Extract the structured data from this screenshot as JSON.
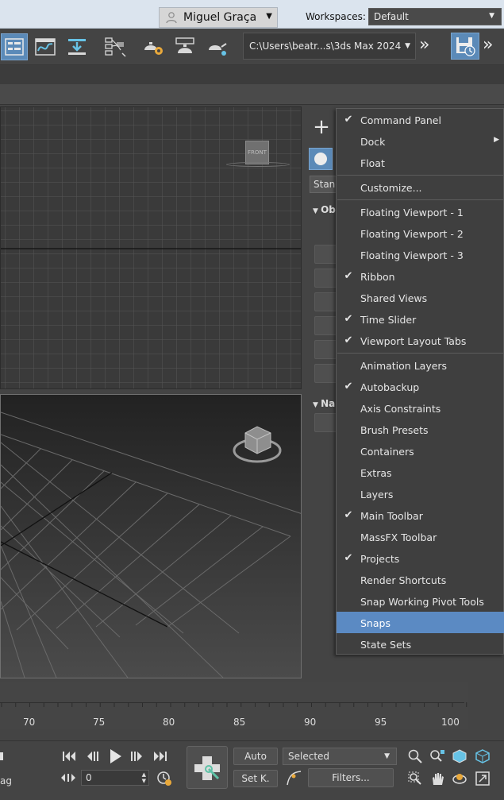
{
  "title_bar": {
    "user_name": "Miguel Graça",
    "workspaces_label": "Workspaces:",
    "workspace_value": "Default"
  },
  "toolbar": {
    "project_path": "C:\\Users\\beatr...s\\3ds Max 2024",
    "overflow_glyph": "»"
  },
  "viewports": {
    "top_viewcube_label": "FRONT"
  },
  "command_panel": {
    "type_field": "Stand",
    "rollout_object_type": "Ob",
    "rollout_name_color": "Na"
  },
  "context_menu": {
    "items": [
      {
        "label": "Command Panel",
        "checked": true
      },
      {
        "label": "Dock",
        "checked": false,
        "submenu": true
      },
      {
        "label": "Float",
        "checked": false
      },
      {
        "label": "Customize...",
        "checked": false
      },
      {
        "label": "Floating Viewport - 1",
        "checked": false
      },
      {
        "label": "Floating Viewport - 2",
        "checked": false
      },
      {
        "label": "Floating Viewport - 3",
        "checked": false
      },
      {
        "label": "Ribbon",
        "checked": true
      },
      {
        "label": "Shared Views",
        "checked": false
      },
      {
        "label": "Time Slider",
        "checked": true
      },
      {
        "label": "Viewport Layout Tabs",
        "checked": true
      },
      {
        "label": "Animation Layers",
        "checked": false
      },
      {
        "label": "Autobackup",
        "checked": true
      },
      {
        "label": "Axis Constraints",
        "checked": false
      },
      {
        "label": "Brush Presets",
        "checked": false
      },
      {
        "label": "Containers",
        "checked": false
      },
      {
        "label": "Extras",
        "checked": false
      },
      {
        "label": "Layers",
        "checked": false
      },
      {
        "label": "Main Toolbar",
        "checked": true
      },
      {
        "label": "MassFX Toolbar",
        "checked": false
      },
      {
        "label": "Projects",
        "checked": true
      },
      {
        "label": "Render Shortcuts",
        "checked": false
      },
      {
        "label": "Snap Working Pivot Tools",
        "checked": false
      },
      {
        "label": "Snaps",
        "checked": false,
        "highlighted": true
      },
      {
        "label": "State Sets",
        "checked": false
      }
    ],
    "check_glyph": "✔",
    "submenu_glyph": "▶"
  },
  "timeline": {
    "ticks": [
      "70",
      "75",
      "80",
      "85",
      "90",
      "95",
      "100"
    ]
  },
  "animation_controls": {
    "current_frame": "0",
    "auto_key_label": "Auto",
    "set_key_label": "Set K.",
    "selection_set": "Selected",
    "filters_label": "Filters...",
    "left_edge_text": "ag"
  },
  "colors": {
    "accent": "#5b8ac3",
    "menu_bg": "#3f3f3f",
    "panel_bg": "#444444"
  }
}
